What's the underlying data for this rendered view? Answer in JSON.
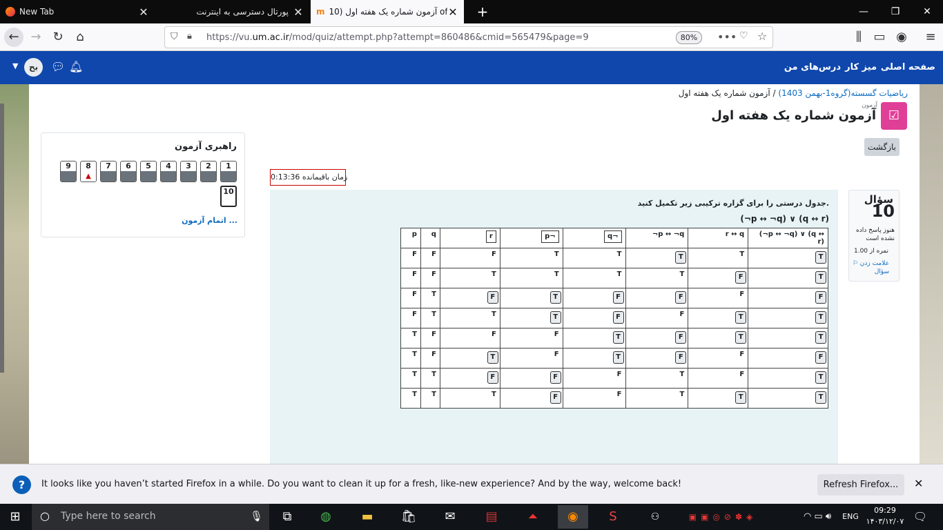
{
  "browser": {
    "tabs": [
      {
        "label": "New Tab",
        "icon": "firefox-icon"
      },
      {
        "label": "پورتال دسترسی به اینترنت",
        "icon": ""
      },
      {
        "label": "آزمون شماره یک هفته اول (10 of",
        "icon": "moodle-icon"
      }
    ],
    "url_prefix": "https://vu.",
    "url_host": "um.ac.ir",
    "url_rest": "/mod/quiz/attempt.php?attempt=860486&cmid=565479&page=9",
    "zoom": "80%"
  },
  "moodle_nav": {
    "home": "صفحه اصلی",
    "dashboard": "میز کار",
    "courses": "درس‌های من",
    "avatar": "بح"
  },
  "breadcrumb": {
    "course": "ریاضیات گسسته(گروه1-بهمن 1403)",
    "sep": "/",
    "current": "آزمون شماره یک هفته اول"
  },
  "header": {
    "sub": "آزمون",
    "title": "آزمون شماره یک هفته اول",
    "back": "بازگشت"
  },
  "quiz_nav": {
    "title": "راهبری آزمون",
    "buttons": [
      "1",
      "2",
      "3",
      "4",
      "5",
      "6",
      "7",
      "8",
      "9",
      "10"
    ],
    "flag_mark": "▲",
    "finish": "اتمام آزمون ..."
  },
  "timer": {
    "label": "زمان باقیمانده",
    "value": "0:13:36",
    "text": "زمان باقیمانده 0:13:36"
  },
  "question": {
    "label": "سؤال",
    "number": "10",
    "state": "هنوز پاسخ داده نشده است",
    "grade": "نمره از 1.00",
    "flag": "علامت زدن سؤال",
    "text": "جدول درستی را برای گزاره ترکیبی زیر تکمیل کنید.",
    "formula": "(¬p ↔ ¬q) ∨ (q ↔ r)"
  },
  "truth_table": {
    "headers": [
      "p",
      "q",
      "r",
      "p¬",
      "q¬",
      "¬p ↔ ¬q",
      "r ↔ q",
      "(¬p ↔ ¬q) ∨ (q ↔ r)"
    ],
    "rows": [
      [
        "F",
        "F",
        "F",
        "T",
        "T",
        "T",
        "T",
        "T"
      ],
      [
        "F",
        "F",
        "T",
        "T",
        "T",
        "T",
        "F",
        "T"
      ],
      [
        "F",
        "T",
        "F",
        "T",
        "F",
        "F",
        "F",
        "F"
      ],
      [
        "F",
        "T",
        "T",
        "T",
        "F",
        "F",
        "T",
        "T"
      ],
      [
        "T",
        "F",
        "F",
        "F",
        "T",
        "F",
        "T",
        "T"
      ],
      [
        "T",
        "F",
        "T",
        "F",
        "T",
        "F",
        "F",
        "F"
      ],
      [
        "T",
        "T",
        "F",
        "F",
        "F",
        "T",
        "F",
        "T"
      ],
      [
        "T",
        "T",
        "T",
        "F",
        "F",
        "T",
        "T",
        "T"
      ]
    ],
    "boxed": [
      [
        0,
        0,
        0,
        0,
        0,
        1,
        0,
        1
      ],
      [
        0,
        0,
        0,
        0,
        0,
        0,
        1,
        1
      ],
      [
        0,
        0,
        1,
        1,
        1,
        1,
        0,
        1
      ],
      [
        0,
        0,
        0,
        1,
        1,
        0,
        1,
        1
      ],
      [
        0,
        0,
        0,
        0,
        1,
        1,
        1,
        1
      ],
      [
        0,
        0,
        1,
        0,
        1,
        1,
        0,
        1
      ],
      [
        0,
        0,
        1,
        1,
        0,
        0,
        0,
        1
      ],
      [
        0,
        0,
        0,
        1,
        0,
        0,
        1,
        1
      ]
    ]
  },
  "drag_items": {
    "vars": [
      "¬p",
      "¬q",
      "r"
    ],
    "values": [
      "T",
      "F"
    ]
  },
  "notification": {
    "message": "It looks like you haven’t started Firefox in a while. Do you want to clean it up for a fresh, like-new experience? And by the way, welcome back!",
    "button": "Refresh Firefox...",
    "close": "✕"
  },
  "taskbar": {
    "search_placeholder": "Type here to search",
    "lang": "ENG",
    "time": "09:29",
    "date": "۱۴۰۳/۱۲/۰۷"
  }
}
